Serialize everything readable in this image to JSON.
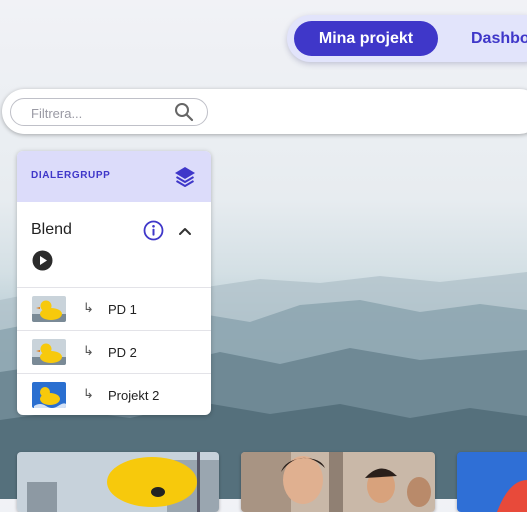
{
  "nav": {
    "tabs": [
      {
        "label": "Mina projekt",
        "active": true
      },
      {
        "label": "Dashbo",
        "active": false
      }
    ]
  },
  "filter": {
    "placeholder": "Filtrera...",
    "value": ""
  },
  "panel": {
    "header_label": "DIALERGRUPP",
    "group_name": "Blend",
    "rows": [
      {
        "arrow": "↳",
        "label": "PD 1",
        "thumb": "duck-thumb"
      },
      {
        "arrow": "↳",
        "label": "PD 2",
        "thumb": "duck-thumb"
      },
      {
        "arrow": "↳",
        "label": "Projekt 2",
        "thumb": "duck-blue-thumb"
      }
    ]
  },
  "colors": {
    "accent": "#3f37c9",
    "accent_light": "#dcdcfa",
    "duck_yellow": "#f7c90c"
  }
}
